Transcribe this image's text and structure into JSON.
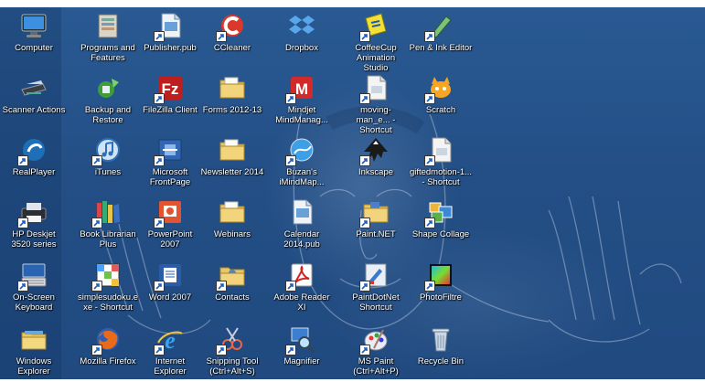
{
  "desktop": {
    "icons": [
      {
        "label": "Computer",
        "icon": "computer-icon",
        "shortcut": false
      },
      {
        "label": "Programs and Features",
        "icon": "programs-icon",
        "shortcut": false
      },
      {
        "label": "Publisher.pub",
        "icon": "publisher-doc-icon",
        "shortcut": true
      },
      {
        "label": "CCleaner",
        "icon": "ccleaner-icon",
        "shortcut": true
      },
      {
        "label": "Dropbox",
        "icon": "dropbox-icon",
        "shortcut": false
      },
      {
        "label": "CoffeeCup Animation Studio",
        "icon": "coffeecup-icon",
        "shortcut": true
      },
      {
        "label": "Pen & Ink Editor",
        "icon": "pen-ink-icon",
        "shortcut": true
      },
      {
        "label": "Scanner Actions",
        "icon": "scanner-icon",
        "shortcut": false
      },
      {
        "label": "Backup and Restore",
        "icon": "backup-icon",
        "shortcut": false
      },
      {
        "label": "FileZilla Client",
        "icon": "filezilla-icon",
        "shortcut": true
      },
      {
        "label": "Forms 2012-13",
        "icon": "folder-icon",
        "shortcut": false
      },
      {
        "label": "Mindjet MindManag...",
        "icon": "mindjet-icon",
        "shortcut": true
      },
      {
        "label": "moving-man_e... - Shortcut",
        "icon": "file-shortcut-icon",
        "shortcut": true
      },
      {
        "label": "Scratch",
        "icon": "scratch-icon",
        "shortcut": true
      },
      {
        "label": "RealPlayer",
        "icon": "realplayer-icon",
        "shortcut": true
      },
      {
        "label": "iTunes",
        "icon": "itunes-icon",
        "shortcut": true
      },
      {
        "label": "Microsoft FrontPage",
        "icon": "frontpage-icon",
        "shortcut": true
      },
      {
        "label": "Newsletter 2014",
        "icon": "folder-icon",
        "shortcut": false
      },
      {
        "label": "Buzan's iMindMap...",
        "icon": "imindmap-icon",
        "shortcut": true
      },
      {
        "label": "Inkscape",
        "icon": "inkscape-icon",
        "shortcut": true
      },
      {
        "label": "giftedmotion-1... - Shortcut",
        "icon": "file-shortcut-icon",
        "shortcut": true
      },
      {
        "label": "HP Deskjet 3520 series",
        "icon": "printer-icon",
        "shortcut": true
      },
      {
        "label": "Book Librarian Plus",
        "icon": "book-librarian-icon",
        "shortcut": true
      },
      {
        "label": "PowerPoint 2007",
        "icon": "powerpoint-icon",
        "shortcut": true
      },
      {
        "label": "Webinars",
        "icon": "folder-icon",
        "shortcut": false
      },
      {
        "label": "Calendar 2014.pub",
        "icon": "publisher-doc-icon",
        "shortcut": false
      },
      {
        "label": "Paint.NET",
        "icon": "paintnet-icon",
        "shortcut": true
      },
      {
        "label": "Shape Collage",
        "icon": "shape-collage-icon",
        "shortcut": true
      },
      {
        "label": "On-Screen Keyboard",
        "icon": "keyboard-icon",
        "shortcut": true
      },
      {
        "label": "simplesudoku.exe - Shortcut",
        "icon": "sudoku-icon",
        "shortcut": true
      },
      {
        "label": "Word 2007",
        "icon": "word-icon",
        "shortcut": true
      },
      {
        "label": "Contacts",
        "icon": "contacts-folder-icon",
        "shortcut": true
      },
      {
        "label": "Adobe Reader XI",
        "icon": "adobe-reader-icon",
        "shortcut": true
      },
      {
        "label": "PaintDotNet Shortcut",
        "icon": "paintdotnet-icon",
        "shortcut": true
      },
      {
        "label": "PhotoFiltre",
        "icon": "photofiltre-icon",
        "shortcut": true
      },
      {
        "label": "Windows Explorer",
        "icon": "explorer-icon",
        "shortcut": false
      },
      {
        "label": "Mozilla Firefox",
        "icon": "firefox-icon",
        "shortcut": true
      },
      {
        "label": "Internet Explorer",
        "icon": "ie-icon",
        "shortcut": true
      },
      {
        "label": "Snipping Tool (Ctrl+Alt+S)",
        "icon": "snipping-tool-icon",
        "shortcut": true
      },
      {
        "label": "Magnifier",
        "icon": "magnifier-icon",
        "shortcut": true
      },
      {
        "label": "MS Paint (Ctrl+Alt+P)",
        "icon": "ms-paint-icon",
        "shortcut": true
      },
      {
        "label": "Recycle Bin",
        "icon": "recycle-bin-icon",
        "shortcut": false
      }
    ]
  },
  "colors": {
    "wallpaper": "#234f86",
    "label_text": "#ffffff"
  }
}
